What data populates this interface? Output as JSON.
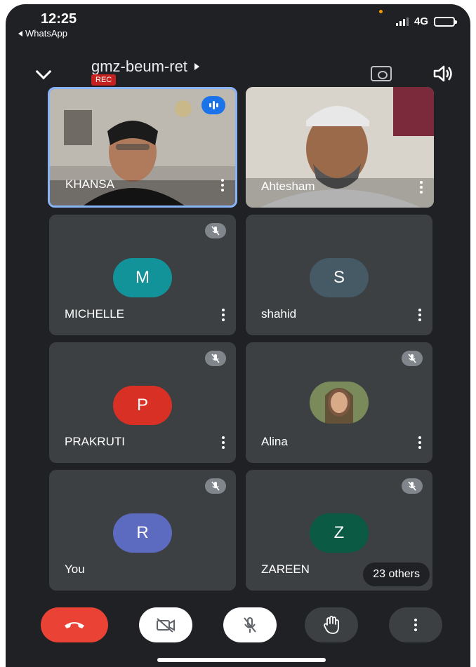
{
  "status_bar": {
    "time": "12:25",
    "back_app": "WhatsApp",
    "network": "4G"
  },
  "header": {
    "meeting_code": "gmz-beum-ret",
    "rec_badge": "REC"
  },
  "participants": [
    {
      "name": "KHANSA",
      "initial": "",
      "video": true,
      "speaking": true,
      "muted": false
    },
    {
      "name": "Ahtesham",
      "initial": "",
      "video": true,
      "speaking": false,
      "muted": false
    },
    {
      "name": "MICHELLE",
      "initial": "M",
      "color": "#12939a",
      "muted": true
    },
    {
      "name": "shahid",
      "initial": "S",
      "color": "#455a64",
      "muted": false
    },
    {
      "name": "PRAKRUTI",
      "initial": "P",
      "color": "#d93025",
      "muted": true
    },
    {
      "name": "Alina",
      "initial": "",
      "photo": true,
      "muted": true
    },
    {
      "name": "You",
      "initial": "R",
      "color": "#5c6bc0",
      "muted": true
    },
    {
      "name": "ZAREEN",
      "initial": "Z",
      "color": "#0b5a44",
      "muted": true
    }
  ],
  "others_label": "23 others",
  "controls": {
    "end_call": "end-call",
    "camera": "camera-off",
    "mic": "mic-off",
    "raise_hand": "raise-hand",
    "more": "more-options"
  },
  "colors": {
    "background": "#202124",
    "tile": "#3c4043",
    "end_call": "#ea4335",
    "accent": "#1a73e8"
  }
}
